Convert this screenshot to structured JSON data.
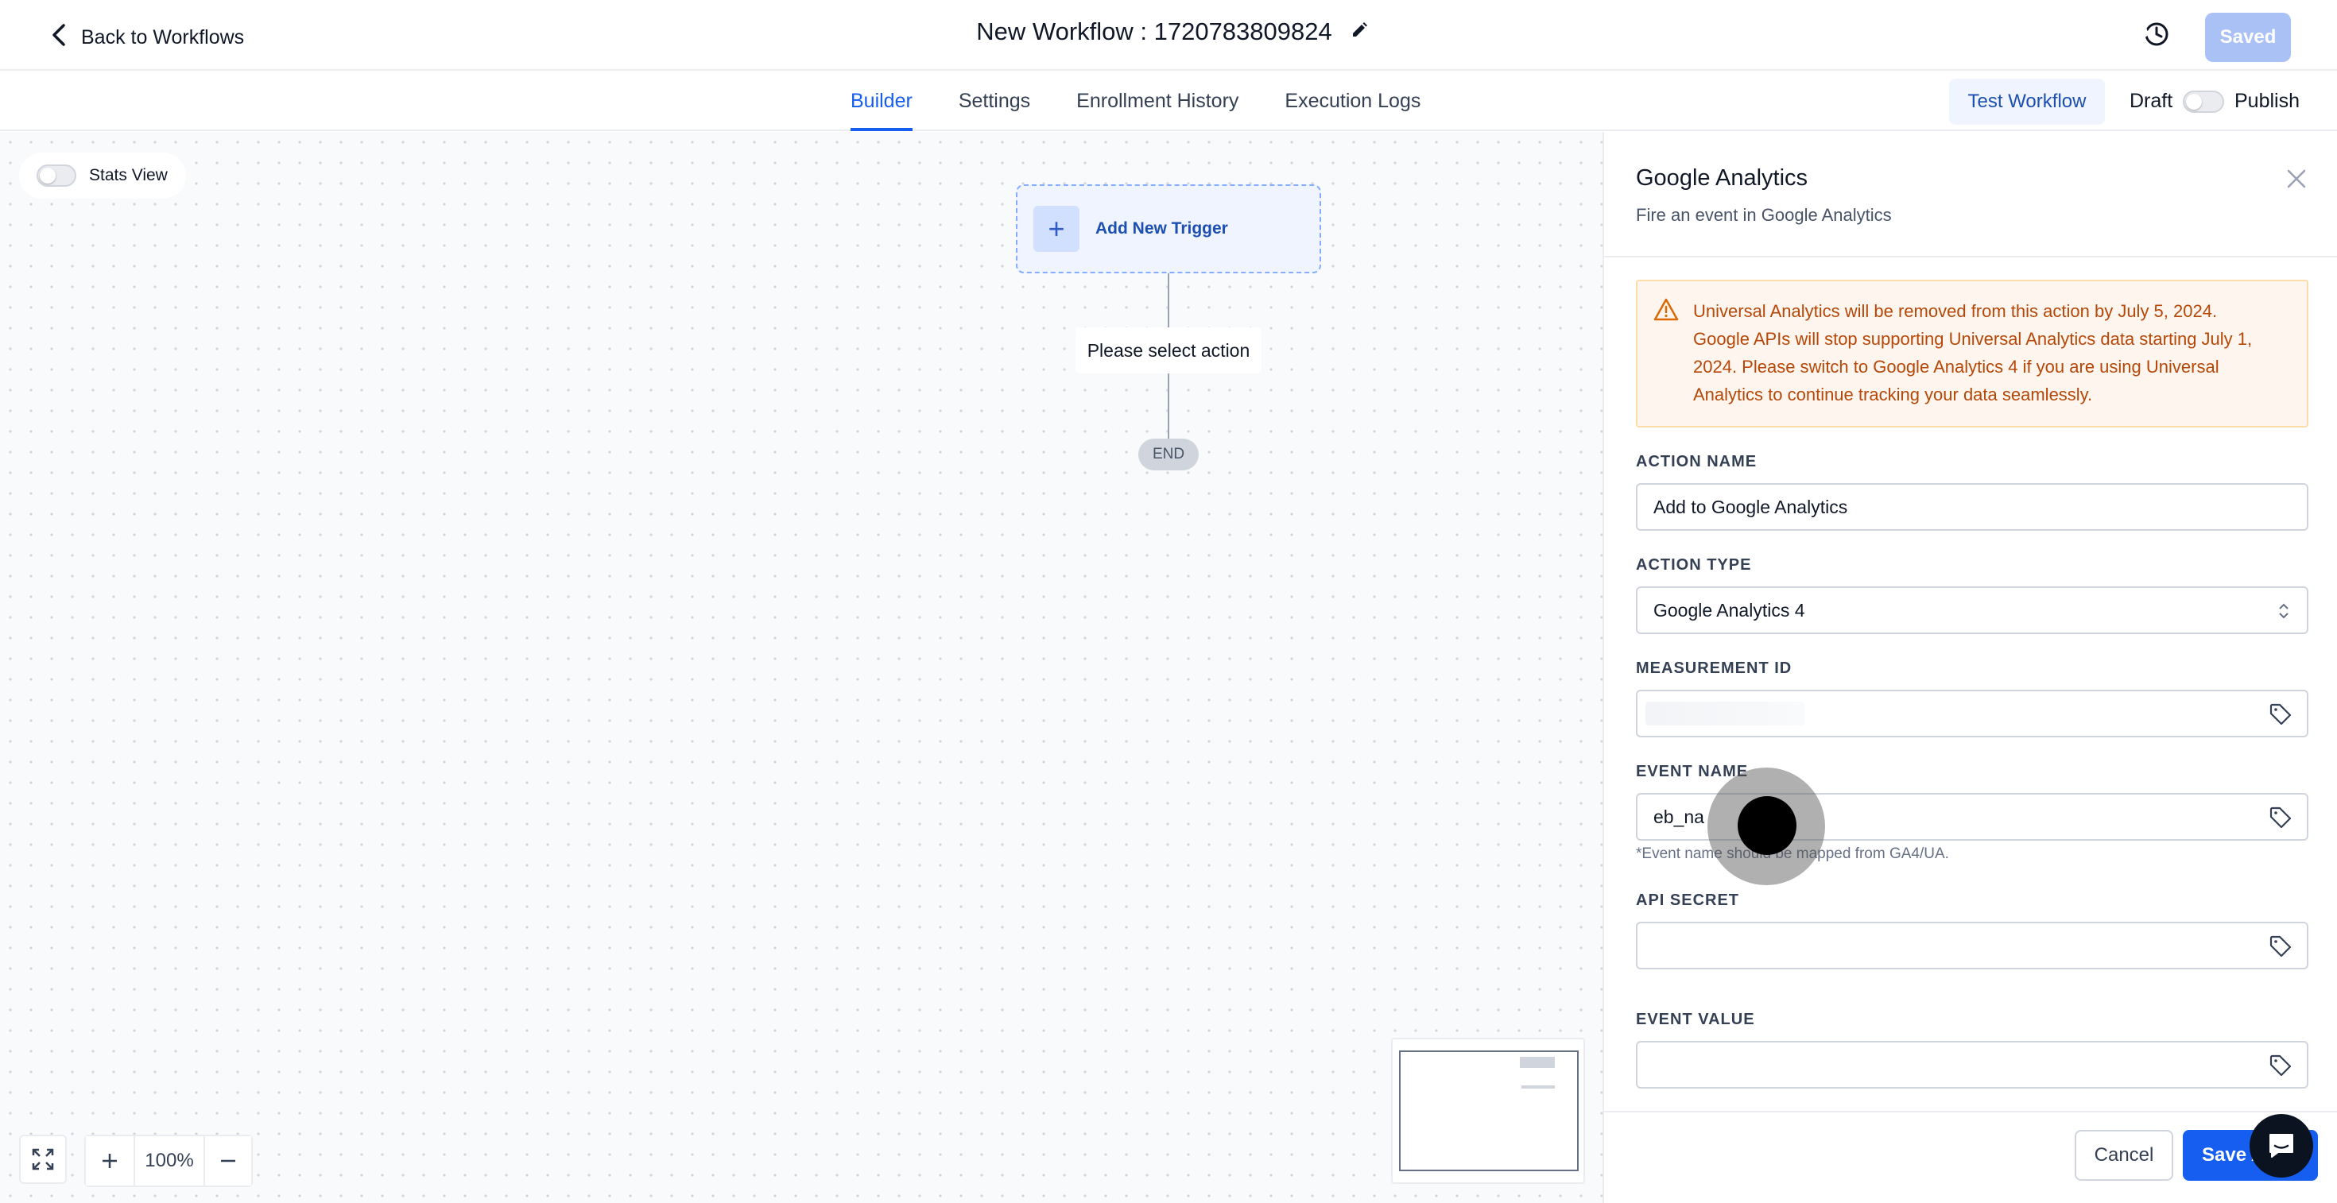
{
  "header": {
    "back_label": "Back to Workflows",
    "workflow_title": "New Workflow : 1720783809824",
    "saved_label": "Saved"
  },
  "tabs": [
    {
      "label": "Builder",
      "active": true
    },
    {
      "label": "Settings",
      "active": false
    },
    {
      "label": "Enrollment History",
      "active": false
    },
    {
      "label": "Execution Logs",
      "active": false
    }
  ],
  "toolbar": {
    "test_workflow_label": "Test Workflow",
    "draft_label": "Draft",
    "publish_label": "Publish",
    "publish_toggle_on": false
  },
  "canvas": {
    "stats_view_label": "Stats View",
    "stats_view_on": false,
    "trigger_label": "Add New Trigger",
    "action_placeholder": "Please select action",
    "end_label": "END",
    "zoom_level": "100%"
  },
  "panel": {
    "title": "Google Analytics",
    "subtitle": "Fire an event in Google Analytics",
    "alert_text": "Universal Analytics will be removed from this action by July 5, 2024. Google APIs will stop supporting Universal Analytics data starting July 1, 2024. Please switch to Google Analytics 4 if you are using Universal Analytics to continue tracking your data seamlessly.",
    "fields": {
      "action_name": {
        "label": "ACTION NAME",
        "value": "Add to Google Analytics"
      },
      "action_type": {
        "label": "ACTION TYPE",
        "value": "Google Analytics 4"
      },
      "measurement_id": {
        "label": "MEASUREMENT ID",
        "value": ""
      },
      "event_name": {
        "label": "EVENT NAME",
        "value": "eb_na",
        "hint": "*Event name should be mapped from GA4/UA."
      },
      "api_secret": {
        "label": "API SECRET",
        "value": ""
      },
      "event_value": {
        "label": "EVENT VALUE",
        "value": ""
      }
    },
    "cancel_label": "Cancel",
    "save_label": "Save Action"
  },
  "colors": {
    "accent": "#155eef",
    "saved_disabled": "#a9c1f5",
    "alert_text": "#b54708",
    "alert_bg": "#fef6ee"
  }
}
